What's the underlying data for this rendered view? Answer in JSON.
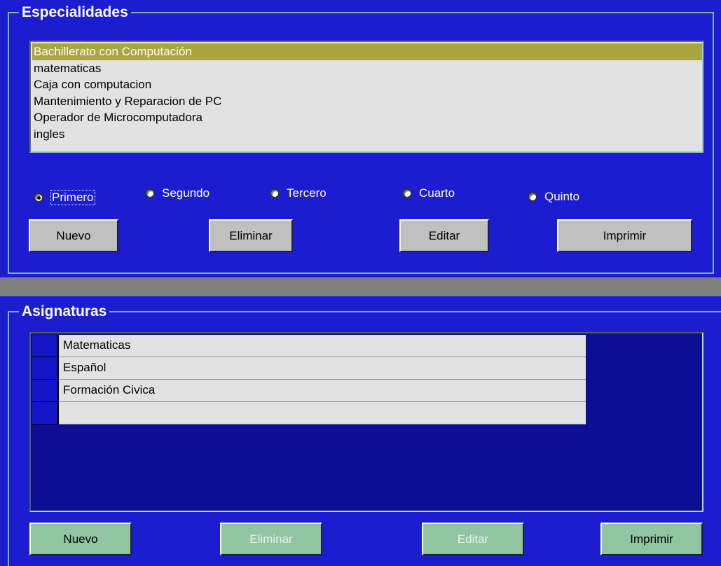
{
  "especialidades": {
    "title": "Especialidades",
    "items": [
      "Bachillerato con Computación",
      "matematicas",
      "Caja con computacion",
      "Mantenimiento y Reparacion de PC",
      "Operador de Microcomputadora",
      "ingles"
    ],
    "selected_index": 0,
    "radios": [
      {
        "label": "Primero",
        "checked": true
      },
      {
        "label": "Segundo",
        "checked": false
      },
      {
        "label": "Tercero",
        "checked": false
      },
      {
        "label": "Cuarto",
        "checked": false
      },
      {
        "label": "Quinto",
        "checked": false
      }
    ],
    "buttons": {
      "nuevo": "Nuevo",
      "eliminar": "Eliminar",
      "editar": "Editar",
      "imprimir": "Imprimir"
    }
  },
  "asignaturas": {
    "title": "Asignaturas",
    "rows": [
      "Matematicas",
      "Español",
      "Formación Civica",
      ""
    ],
    "buttons": {
      "nuevo": "Nuevo",
      "eliminar": "Eliminar",
      "editar": "Editar",
      "imprimir": "Imprimir"
    }
  },
  "colors": {
    "background": "#1c1cd0",
    "selection": "#aaa53f",
    "green_button": "#8fc5a0",
    "separator": "#808080"
  }
}
